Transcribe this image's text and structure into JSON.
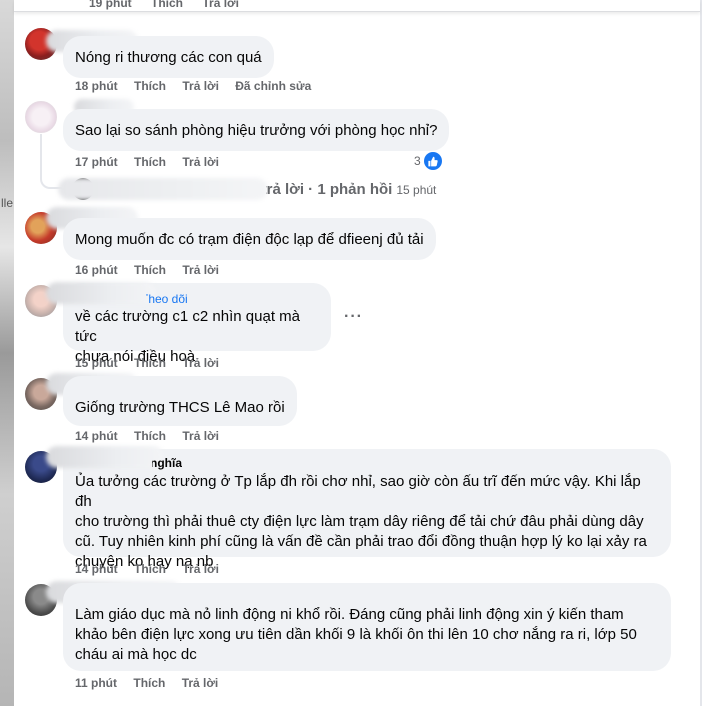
{
  "top_actions": {
    "time": "19 phút",
    "like": "Thích",
    "reply": "Trả lời"
  },
  "left_strip_text": "lle",
  "comments": [
    {
      "text": "Nóng ri thương các con quá",
      "time": "18 phút",
      "like": "Thích",
      "reply": "Trả lời",
      "edited": "Đã chỉnh sửa"
    },
    {
      "text": "Sao lại so sánh phòng hiệu trưởng với phòng học nhỉ?",
      "time": "17 phút",
      "like": "Thích",
      "reply": "Trả lời",
      "reaction_count": "3",
      "replies_link": "đã trả lời · 1 phản hồi",
      "replies_time": "15 phút"
    },
    {
      "text": "Mong muốn đc có trạm điện độc lạp để dfieenj đủ tải",
      "time": "16 phút",
      "like": "Thích",
      "reply": "Trả lời"
    },
    {
      "follow": "Theo dõi",
      "text_lines": [
        "về các trường c1 c2 nhìn quạt mà tức",
        "chưa nói điều hoà"
      ],
      "time": "15 phút",
      "like": "Thích",
      "reply": "Trả lời",
      "more": "···"
    },
    {
      "text": "Giống trường THCS Lê Mao rồi",
      "time": "14 phút",
      "like": "Thích",
      "reply": "Trả lời"
    },
    {
      "name_fragment": "nghĩa",
      "text_lines": [
        "Ủa tưởng các trường ở Tp lắp đh rồi chơ nhỉ, sao giờ còn ấu trĩ đến mức vậy. Khi lắp đh",
        "cho trường thì phải thuê cty điện lực làm trạm dây riêng để tải chứ đâu phải dùng dây",
        "cũ. Tuy nhiên kinh phí cũng là vấn đề cần phải trao đổi đồng thuận hợp lý ko lại xảy ra",
        "chuyện ko hay nạ nb"
      ],
      "time": "14 phút",
      "like": "Thích",
      "reply": "Trả lời"
    },
    {
      "text_lines": [
        "Làm giáo dục mà nỏ linh động ni khổ rồi. Đáng cũng phải linh động xin ý kiến tham",
        "khảo bên điện lực xong ưu tiên dần khối 9 là khối ôn thi lên 10 chơ nắng ra ri, lớp 50",
        "cháu ai mà học dc"
      ],
      "time": "11 phút",
      "like": "Thích",
      "reply": "Trả lời"
    }
  ],
  "colors": {
    "bubble": "#f0f2f5",
    "meta": "#65676b",
    "link": "#1877f2",
    "text": "#050505"
  }
}
